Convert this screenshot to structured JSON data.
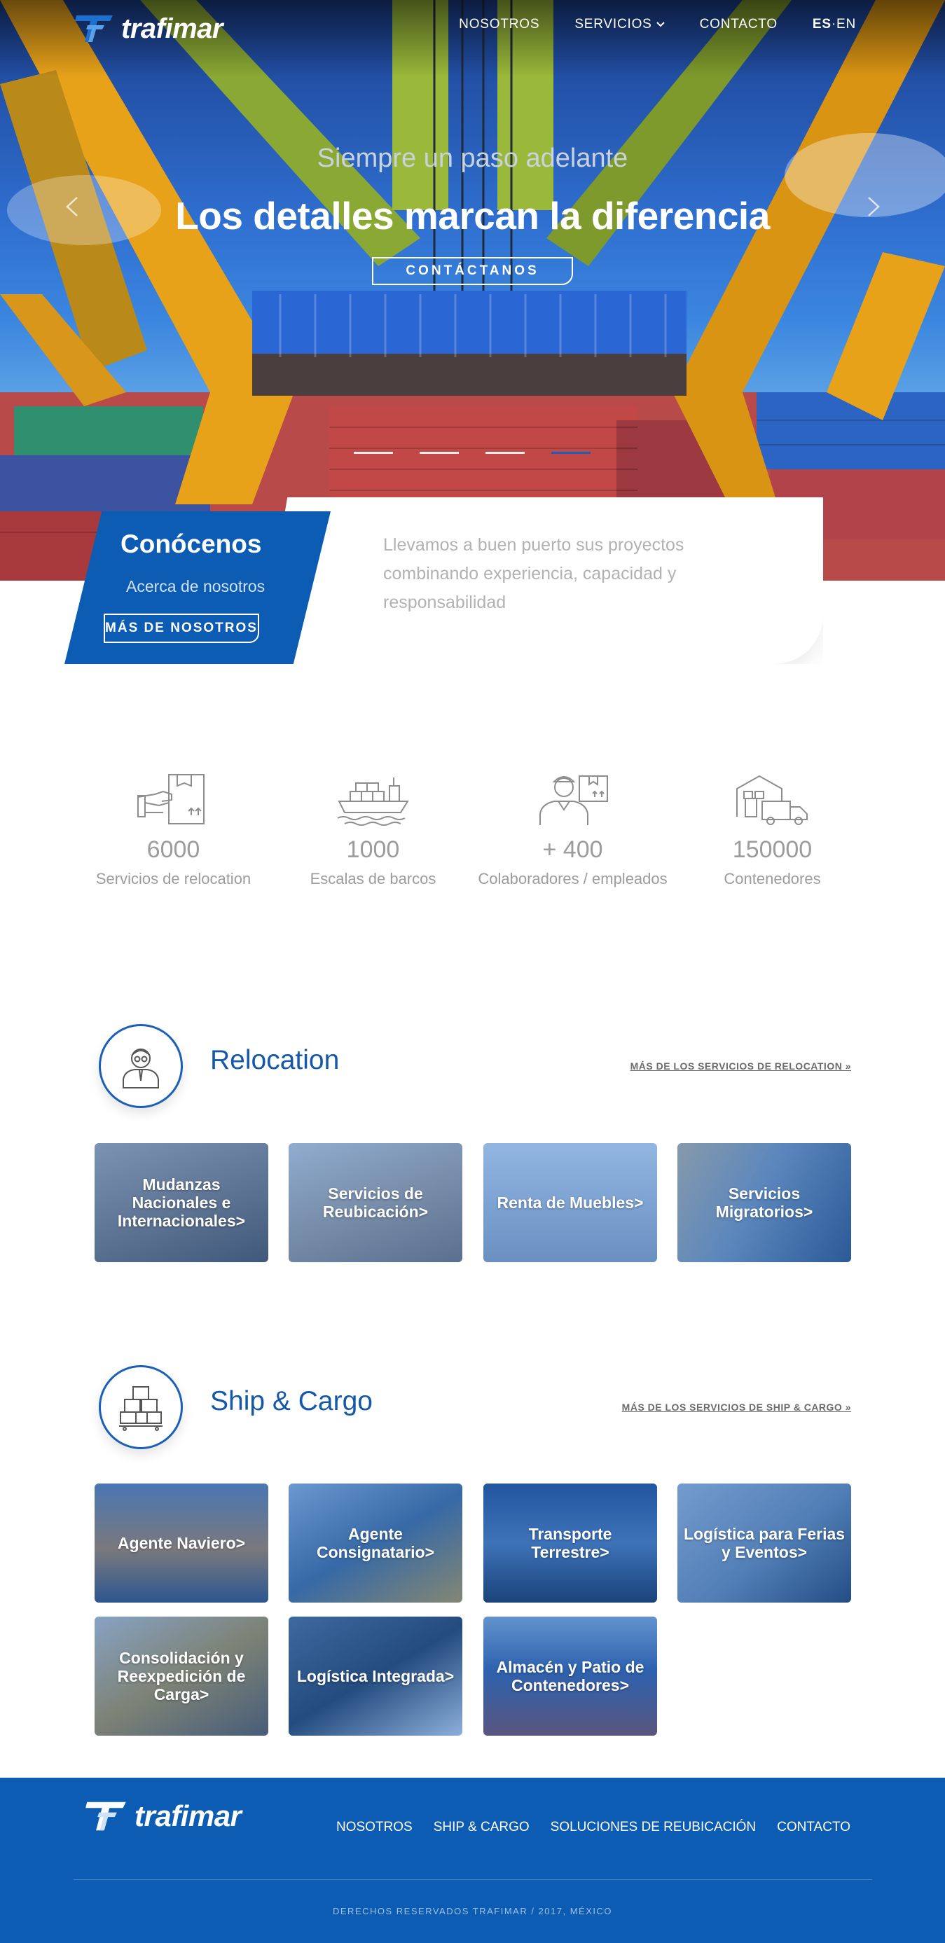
{
  "brand": {
    "name": "trafimar"
  },
  "nav": {
    "items": [
      "NOSOTROS",
      "SERVICIOS",
      "CONTACTO"
    ],
    "lang_active": "ES",
    "lang_sep": "·",
    "lang_other": "EN"
  },
  "hero": {
    "tagline": "Siempre un paso adelante",
    "headline": "Los detalles marcan la diferencia",
    "cta": "CONTÁCTANOS",
    "slides": 4,
    "active_slide": 4
  },
  "about": {
    "title": "Conócenos",
    "subtitle": "Acerca de nosotros",
    "button": "MÁS DE NOSOTROS",
    "text": "Llevamos a buen puerto sus proyectos combinando experiencia, capacidad y responsabilidad"
  },
  "stats": [
    {
      "icon": "box-hand-icon",
      "value": "6000",
      "label": "Servicios de relocation"
    },
    {
      "icon": "ship-icon",
      "value": "1000",
      "label": "Escalas de barcos"
    },
    {
      "icon": "worker-icon",
      "value": "+ 400",
      "label": "Colaboradores / empleados"
    },
    {
      "icon": "warehouse-truck-icon",
      "value": "150000",
      "label": "Contenedores"
    }
  ],
  "relocation": {
    "title": "Relocation",
    "more": "MÁS DE LOS SERVICIOS DE RELOCATION »",
    "icon": "person-icon",
    "tiles": [
      "Mudanzas Nacionales e Internacionales>",
      "Servicios de Reubicación>",
      "Renta de Muebles>",
      "Servicios Migratorios>"
    ]
  },
  "shipcargo": {
    "title": "Ship & Cargo",
    "more": "MÁS DE LOS SERVICIOS DE SHIP & CARGO »",
    "icon": "boxes-icon",
    "tiles": [
      "Agente Naviero>",
      "Agente Consignatario>",
      "Transporte Terrestre>",
      "Logística para Ferias y Eventos>",
      "Consolidación y Reexpedición de Carga>",
      "Logística Integrada>",
      "Almacén y Patio de Contenedores>"
    ]
  },
  "footer": {
    "links": [
      "NOSOTROS",
      "SHIP & CARGO",
      "SOLUCIONES DE REUBICACIÓN",
      "CONTACTO"
    ],
    "copyright": "DERECHOS RESERVADOS TRAFIMAR / 2017, MÉXICO"
  },
  "colors": {
    "brand_blue": "#0d5cb3",
    "title_blue": "#1558aa",
    "gray_text": "#9c9c9c"
  }
}
